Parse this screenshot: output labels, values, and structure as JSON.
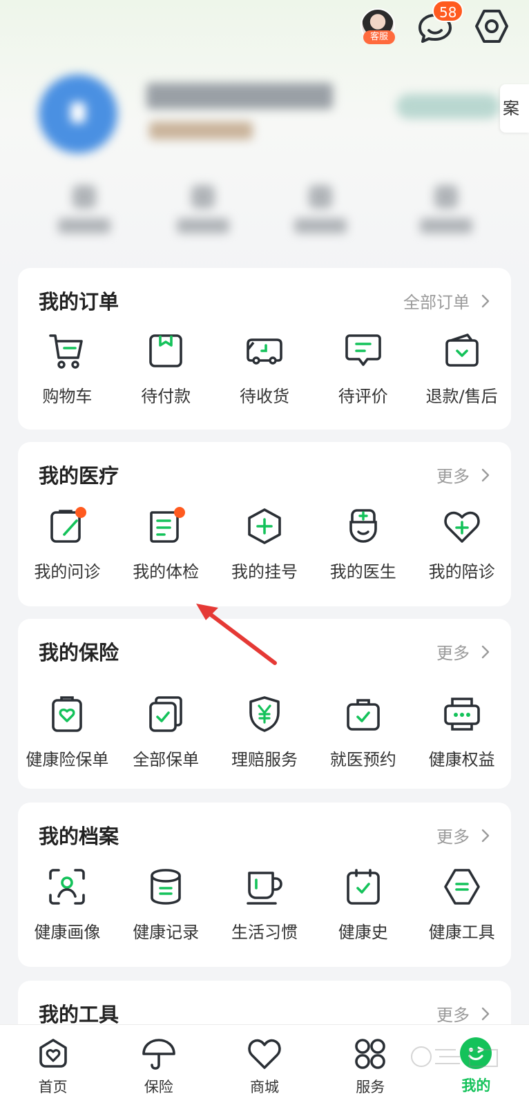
{
  "topbar": {
    "customer_service_label": "客服",
    "message_count": "58",
    "side_tab_label": "案"
  },
  "orders": {
    "title": "我的订单",
    "more_label": "全部订单",
    "items": [
      {
        "label": "购物车",
        "icon": "cart-icon"
      },
      {
        "label": "待付款",
        "icon": "wallet-icon"
      },
      {
        "label": "待收货",
        "icon": "truck-icon"
      },
      {
        "label": "待评价",
        "icon": "comment-icon"
      },
      {
        "label": "退款/售后",
        "icon": "refund-icon"
      }
    ]
  },
  "medical": {
    "title": "我的医疗",
    "more_label": "更多",
    "items": [
      {
        "label": "我的问诊",
        "icon": "consult-icon",
        "dot": true
      },
      {
        "label": "我的体检",
        "icon": "checkup-icon",
        "dot": true
      },
      {
        "label": "我的挂号",
        "icon": "register-icon"
      },
      {
        "label": "我的医生",
        "icon": "doctor-icon"
      },
      {
        "label": "我的陪诊",
        "icon": "escort-icon"
      }
    ]
  },
  "insurance": {
    "title": "我的保险",
    "more_label": "更多",
    "items": [
      {
        "label": "健康险保单",
        "icon": "health-policy-icon"
      },
      {
        "label": "全部保单",
        "icon": "all-policies-icon"
      },
      {
        "label": "理赔服务",
        "icon": "claim-shield-icon"
      },
      {
        "label": "就医预约",
        "icon": "appointment-bag-icon"
      },
      {
        "label": "健康权益",
        "icon": "benefits-icon"
      }
    ]
  },
  "records": {
    "title": "我的档案",
    "more_label": "更多",
    "items": [
      {
        "label": "健康画像",
        "icon": "profile-scan-icon"
      },
      {
        "label": "健康记录",
        "icon": "record-icon"
      },
      {
        "label": "生活习惯",
        "icon": "cup-icon"
      },
      {
        "label": "健康史",
        "icon": "history-calendar-icon"
      },
      {
        "label": "健康工具",
        "icon": "tools-icon"
      }
    ]
  },
  "tools": {
    "title": "我的工具",
    "more_label": "更多"
  },
  "tabbar": {
    "items": [
      {
        "label": "首页",
        "icon": "home-icon"
      },
      {
        "label": "保险",
        "icon": "umbrella-icon"
      },
      {
        "label": "商城",
        "icon": "heart-icon"
      },
      {
        "label": "服务",
        "icon": "grid-icon"
      },
      {
        "label": "我的",
        "icon": "me-icon",
        "active": true
      }
    ]
  },
  "colors": {
    "accent": "#14c25a",
    "icon_stroke": "#2a2f35",
    "badge": "#ff5a1f",
    "annotation_arrow": "#e53935"
  }
}
